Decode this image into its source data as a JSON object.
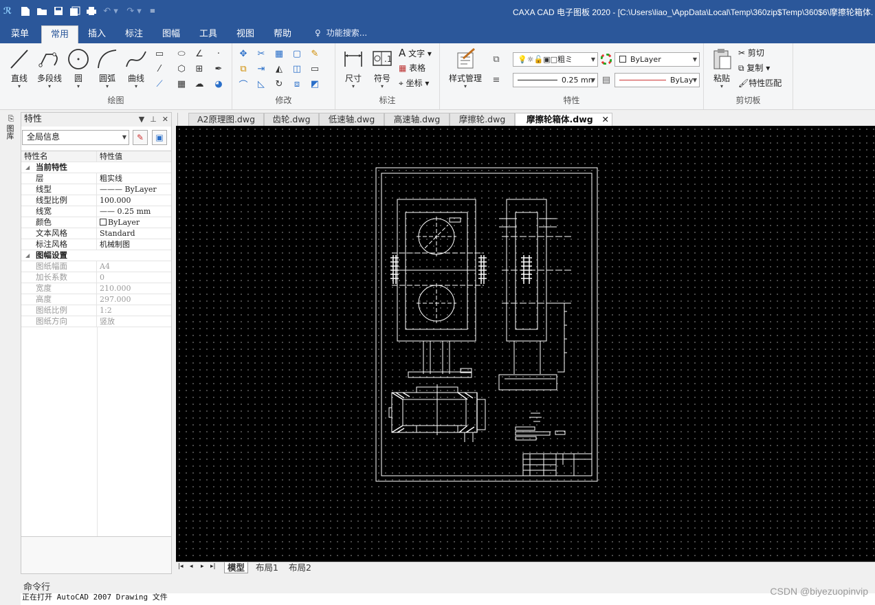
{
  "window": {
    "title": "CAXA CAD 电子图板 2020 - [C:\\Users\\liao_\\AppData\\Local\\Temp\\360zip$Temp\\360$6\\摩擦轮箱体."
  },
  "menu": {
    "tabs": [
      "菜单",
      "常用",
      "插入",
      "标注",
      "图幅",
      "工具",
      "视图",
      "帮助"
    ],
    "active": "常用",
    "search_label": "功能搜索..."
  },
  "ribbon": {
    "draw": {
      "title": "绘图",
      "line": "直线",
      "polyline": "多段线",
      "circle": "圆",
      "arc": "圆弧",
      "curve": "曲线"
    },
    "modify": {
      "title": "修改"
    },
    "annotate": {
      "title": "标注",
      "dimension": "尺寸",
      "symbol": "符号",
      "text": "文字",
      "table": "表格",
      "coordinate": "坐标"
    },
    "properties": {
      "title": "特性",
      "style_manager": "样式管理",
      "layer_value": "粗ミ",
      "color_value": "ByLayer",
      "lineweight_value": "0.25 mn",
      "linetype_value": "ByLay"
    },
    "clipboard": {
      "title": "剪切板",
      "paste": "粘贴",
      "cut": "剪切",
      "copy": "复制",
      "match": "特性匹配"
    }
  },
  "side_tab": {
    "label": "图库"
  },
  "properties_panel": {
    "title": "特性",
    "selector": "全局信息",
    "col_name": "特性名",
    "col_value": "特性值",
    "rows": [
      {
        "k": "当前特性",
        "v": "",
        "type": "cat"
      },
      {
        "k": "层",
        "v": "粗实线",
        "type": ""
      },
      {
        "k": "线型",
        "v": "——— ByLayer",
        "type": ""
      },
      {
        "k": "线型比例",
        "v": "100.000",
        "type": ""
      },
      {
        "k": "线宽",
        "v": "—— 0.25 mm",
        "type": ""
      },
      {
        "k": "颜色",
        "v": "ByLayer",
        "type": "color"
      },
      {
        "k": "文本风格",
        "v": "Standard",
        "type": ""
      },
      {
        "k": "标注风格",
        "v": "机械制图",
        "type": ""
      },
      {
        "k": "图幅设置",
        "v": "",
        "type": "cat"
      },
      {
        "k": "图纸幅面",
        "v": "A4",
        "type": "dis"
      },
      {
        "k": "加长系数",
        "v": "0",
        "type": "dis"
      },
      {
        "k": "宽度",
        "v": "210.000",
        "type": "dis"
      },
      {
        "k": "高度",
        "v": "297.000",
        "type": "dis"
      },
      {
        "k": "图纸比例",
        "v": "1:2",
        "type": "dis"
      },
      {
        "k": "图纸方向",
        "v": "竖放",
        "type": "dis"
      }
    ]
  },
  "doc_tabs": [
    "A2原理图.dwg",
    "齿轮.dwg",
    "低速轴.dwg",
    "高速轴.dwg",
    "摩擦轮.dwg",
    "摩擦轮箱体.dwg"
  ],
  "active_doc": "摩擦轮箱体.dwg",
  "layout_tabs": [
    "模型",
    "布局1",
    "布局2"
  ],
  "command": {
    "title": "命令行",
    "output": "正在打开 AutoCAD 2007 Drawing 文件"
  },
  "watermark": "CSDN @biyezuopinvip"
}
